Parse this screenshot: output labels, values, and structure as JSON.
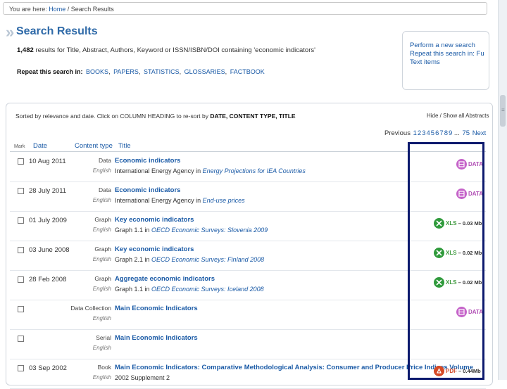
{
  "breadcrumb": {
    "prefix": "You are here:",
    "home": "Home",
    "sep": " / ",
    "current": "Search Results"
  },
  "page": {
    "title": "Search Results"
  },
  "results": {
    "count": "1,482",
    "text": " results for Title, Abstract, Authors, Keyword or ISSN/ISBN/DOI containing 'economic indicators'"
  },
  "repeat": {
    "label": "Repeat this search in:",
    "links": [
      "BOOKS",
      "PAPERS",
      "STATISTICS",
      "GLOSSARIES",
      "FACTBOOK"
    ]
  },
  "side_box": {
    "links": [
      "Perform a new search",
      "Repeat this search in: Fu",
      "Text items"
    ]
  },
  "sort_note": {
    "text": "Sorted by relevance and date. Click on COLUMN HEADING to re-sort by",
    "bold": "DATE, CONTENT TYPE, TITLE"
  },
  "hide_show": "Hide / Show all Abstracts",
  "pager": {
    "prev": "Previous",
    "pages": [
      "1",
      "2",
      "3",
      "4",
      "5",
      "6",
      "7",
      "8",
      "9",
      "...",
      "75"
    ],
    "next": "Next"
  },
  "columns": {
    "mark": "Mark",
    "date": "Date",
    "ctype": "Content type",
    "title": "Title"
  },
  "rows": [
    {
      "date": "10 Aug 2011",
      "ctype": "Data",
      "lang": "English",
      "title": "Economic indicators",
      "sub_plain": "International Energy Agency in ",
      "sub_ital": "Energy Projections for IEA Countries",
      "format": "DATA",
      "size": ""
    },
    {
      "date": "28 July 2011",
      "ctype": "Data",
      "lang": "English",
      "title": "Economic indicators",
      "sub_plain": "International Energy Agency in ",
      "sub_ital": "End-use prices",
      "format": "DATA",
      "size": ""
    },
    {
      "date": "01 July 2009",
      "ctype": "Graph",
      "lang": "English",
      "title": "Key economic indicators",
      "sub_plain": "Graph 1.1 in ",
      "sub_ital": "OECD Economic Surveys: Slovenia 2009",
      "format": "XLS",
      "size": "– 0.03 Mb"
    },
    {
      "date": "03 June 2008",
      "ctype": "Graph",
      "lang": "English",
      "title": "Key economic indicators",
      "sub_plain": "Graph 2.1 in ",
      "sub_ital": "OECD Economic Surveys: Finland 2008",
      "format": "XLS",
      "size": "– 0.02 Mb"
    },
    {
      "date": "28 Feb 2008",
      "ctype": "Graph",
      "lang": "English",
      "title": "Aggregate economic indicators",
      "sub_plain": "Graph 1.1 in ",
      "sub_ital": "OECD Economic Surveys: Iceland 2008",
      "format": "XLS",
      "size": "– 0.02 Mb"
    },
    {
      "date": "",
      "ctype": "Data Collection",
      "lang": "English",
      "title": "Main Economic Indicators",
      "sub_plain": "",
      "sub_ital": "",
      "format": "DATA",
      "size": ""
    },
    {
      "date": "",
      "ctype": "Serial",
      "lang": "English",
      "title": "Main Economic Indicators",
      "sub_plain": "",
      "sub_ital": "",
      "format": "",
      "size": ""
    },
    {
      "date": "03 Sep 2002",
      "ctype": "Book",
      "lang": "English",
      "title": "Main Economic Indicators: Comparative Methodological Analysis: Consumer and Producer Price Indices Volume",
      "sub_plain": "2002 Supplement 2",
      "sub_ital": "",
      "format": "PDF",
      "size": "– 0.44Mb"
    }
  ],
  "colors": {
    "link": "#1a5aa6",
    "title": "#2f6aa8",
    "highlight": "#0d1a6e",
    "data_badge": "#c563c9",
    "xls_badge": "#2f9a3b",
    "pdf_badge": "#d64a26"
  }
}
